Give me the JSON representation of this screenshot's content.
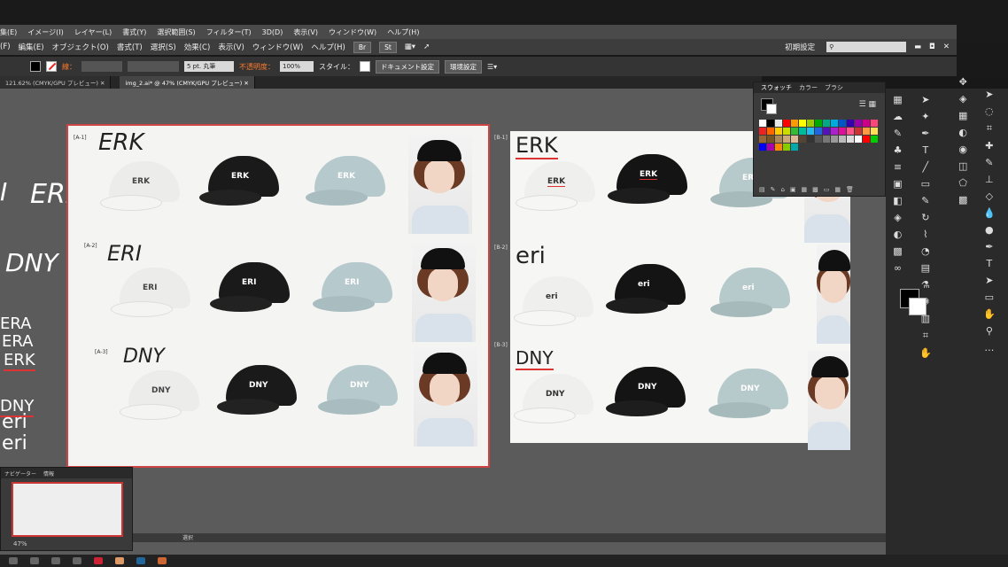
{
  "app_menu": [
    "集(E)",
    "イメージ(I)",
    "レイヤー(L)",
    "書式(Y)",
    "選択範囲(S)",
    "フィルター(T)",
    "3D(D)",
    "表示(V)",
    "ウィンドウ(W)",
    "ヘルプ(H)"
  ],
  "illustrator_menu": [
    "(F)",
    "編集(E)",
    "オブジェクト(O)",
    "書式(T)",
    "選択(S)",
    "効果(C)",
    "表示(V)",
    "ウィンドウ(W)",
    "ヘルプ(H)"
  ],
  "menu_icons": {
    "br": "Br",
    "st": "St"
  },
  "workspace": {
    "label": "初期設定",
    "search_placeholder": ""
  },
  "control": {
    "stroke_label": "線：",
    "brush_size": "5 pt. 丸筆",
    "opacity_label": "不透明度：",
    "opacity_value": "100%",
    "style_label": "スタイル：",
    "doc_settings": "ドキュメント設定",
    "env_settings": "環境設定"
  },
  "tabs": [
    {
      "label": "121.62% (CMYK/GPU プレビュー)"
    },
    {
      "label": "img_2.ai* @ 47% (CMYK/GPU プレビュー)"
    }
  ],
  "swatch_panel": {
    "tabs": [
      "スウォッチ",
      "カラー",
      "ブラシ"
    ],
    "colors": [
      "#ffffff",
      "#000000",
      "#e8e8e8",
      "#ff0000",
      "#ff9900",
      "#ffff00",
      "#99cc00",
      "#00aa00",
      "#00aa88",
      "#00aadd",
      "#0055cc",
      "#3300aa",
      "#9900aa",
      "#cc0088",
      "#ff4477",
      "#ee2222",
      "#ff6600",
      "#ffcc00",
      "#ccdd00",
      "#33bb33",
      "#00bb99",
      "#22bbee",
      "#2266dd",
      "#5511bb",
      "#aa22cc",
      "#dd1199",
      "#ff5588",
      "#cc3333",
      "#ff9944",
      "#ffdd55",
      "#996633",
      "#775522",
      "#aa8855",
      "#ccaa77",
      "#ddbb99",
      "#554433",
      "#333333",
      "#555555",
      "#777777",
      "#999999",
      "#bbbbbb",
      "#dddddd",
      "#ffffff",
      "#ff0000",
      "#00cc00",
      "#0000ff",
      "#aa00aa",
      "#ff8800",
      "#88cc00",
      "#00aaaa"
    ]
  },
  "artboard_a": {
    "rows": [
      {
        "id": "[A-1]",
        "logo": "ERK"
      },
      {
        "id": "[A-2]",
        "logo": "ERI"
      },
      {
        "id": "[A-3]",
        "logo": "DNY"
      }
    ],
    "cap_colors": [
      "#f1f1f0",
      "#1a1a1a",
      "#b6c9cc"
    ]
  },
  "artboard_b": {
    "rows": [
      {
        "id": "[B-1]",
        "logo": "ERK"
      },
      {
        "id": "[B-2]",
        "logo": "eri"
      },
      {
        "id": "[B-3]",
        "logo": "DNY"
      }
    ],
    "cap_colors": [
      "#f3f3f3",
      "#141414",
      "#b7cacb"
    ]
  },
  "left_logos": [
    "I",
    "ERK",
    "DNY",
    "ERA",
    "ERA",
    "ERK",
    "DNY",
    "eri",
    "eri"
  ],
  "navigator": {
    "title": "ナビゲーター",
    "tab2": "情報",
    "zoom": "47%"
  },
  "status": {
    "text": "選択"
  }
}
